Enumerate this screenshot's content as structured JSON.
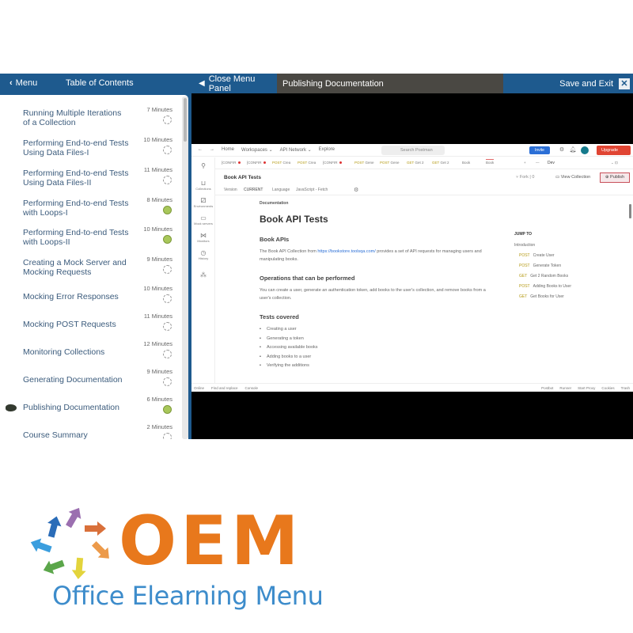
{
  "topbar": {
    "menu_label": "Menu",
    "toc_label": "Table of Contents",
    "close_panel_label": "Close Menu Panel",
    "current_title": "Publishing Documentation",
    "save_exit_label": "Save and Exit",
    "close_icon": "✕",
    "colors": {
      "primary": "#1e5a8e",
      "title_bg": "#4a4843"
    }
  },
  "toc": {
    "items": [
      {
        "label": "Running Multiple Iterations of a Collection",
        "duration": "7 Minutes",
        "status": "incomplete"
      },
      {
        "label": "Performing End-to-end Tests Using Data Files-I",
        "duration": "10 Minutes",
        "status": "incomplete"
      },
      {
        "label": "Performing End-to-end Tests Using Data Files-II",
        "duration": "11 Minutes",
        "status": "incomplete"
      },
      {
        "label": "Performing End-to-end Tests with Loops-I",
        "duration": "8 Minutes",
        "status": "complete"
      },
      {
        "label": "Performing End-to-end Tests with Loops-II",
        "duration": "10 Minutes",
        "status": "complete"
      },
      {
        "label": "Creating a Mock Server and Mocking Requests",
        "duration": "9 Minutes",
        "status": "incomplete"
      },
      {
        "label": "Mocking Error Responses",
        "duration": "10 Minutes",
        "status": "incomplete"
      },
      {
        "label": "Mocking POST Requests",
        "duration": "11 Minutes",
        "status": "incomplete"
      },
      {
        "label": "Monitoring Collections",
        "duration": "12 Minutes",
        "status": "incomplete"
      },
      {
        "label": "Generating Documentation",
        "duration": "9 Minutes",
        "status": "incomplete"
      },
      {
        "label": "Publishing Documentation",
        "duration": "6 Minutes",
        "status": "complete",
        "current": true
      },
      {
        "label": "Course Summary",
        "duration": "2 Minutes",
        "status": "incomplete"
      }
    ],
    "status_colors": {
      "complete": "#a8c75a"
    }
  },
  "postman": {
    "nav": [
      "←",
      "→",
      "Home",
      "Workspaces ⌄",
      "API Network ⌄",
      "Explore"
    ],
    "search_placeholder": "Search Postman",
    "invite_label": "Invite",
    "upgrade_label": "Upgrade",
    "tabs": [
      {
        "label": "[CONFIR",
        "method": "",
        "dot": true
      },
      {
        "label": "[CONFIR",
        "method": "",
        "dot": true
      },
      {
        "label": "Crea",
        "method": "POST",
        "dot": false
      },
      {
        "label": "Crea",
        "method": "POST",
        "dot": false
      },
      {
        "label": "[CONFIR",
        "method": "",
        "dot": true
      },
      {
        "label": "Gene",
        "method": "POST",
        "dot": false
      },
      {
        "label": "Gene",
        "method": "POST",
        "dot": false
      },
      {
        "label": "Get 2",
        "method": "GET",
        "dot": false
      },
      {
        "label": "Get 2",
        "method": "GET",
        "dot": false
      },
      {
        "label": "Book",
        "method": "",
        "dot": false
      },
      {
        "label": "Book",
        "method": "",
        "dot": false,
        "active": true
      }
    ],
    "environment": "Dev",
    "sidebar": [
      {
        "glyph": "⚲",
        "label": ""
      },
      {
        "glyph": "⊔",
        "label": "Collections"
      },
      {
        "glyph": "⚂",
        "label": "Environments"
      },
      {
        "glyph": "▭",
        "label": "Mock servers"
      },
      {
        "glyph": "⋈",
        "label": "Monitors"
      },
      {
        "glyph": "◷",
        "label": "History"
      },
      {
        "glyph": "⁂",
        "label": ""
      }
    ],
    "doc_title": "Book API Tests",
    "fork_label": "Fork",
    "fork_count": "0",
    "view_collection_label": "View Collection",
    "publish_label": "Publish",
    "version_label": "Version",
    "version_value": "CURRENT",
    "language_label": "Language",
    "language_value": "JavaScript - Fetch",
    "content": {
      "section_label": "Documentation",
      "title": "Book API Tests",
      "h_book_apis": "Book APIs",
      "p_intro_before": "The Book API Collection from ",
      "p_intro_link": "https://bookstore.toolsqa.com/",
      "p_intro_after": " provides a set of API requests for managing users and manipulating books.",
      "h_operations": "Operations that can be performed",
      "p_operations": "You can create a user, generate an authentication token, add books to the user's collection, and remove books from a user's collection.",
      "h_tests": "Tests covered",
      "tests": [
        "Creating a user",
        "Generating a token",
        "Accessing available books",
        "Adding books to a user",
        "Verifying the additions"
      ]
    },
    "jump_to": {
      "heading": "JUMP TO",
      "intro": "Introduction",
      "entries": [
        {
          "method": "POST",
          "label": "Create User"
        },
        {
          "method": "POST",
          "label": "Generate Token"
        },
        {
          "method": "GET",
          "label": "Get 2 Random Books"
        },
        {
          "method": "POST",
          "label": "Adding Books to User"
        },
        {
          "method": "GET",
          "label": "Get Books for User"
        }
      ]
    },
    "status_left": [
      "Online",
      "Find and replace",
      "Console"
    ],
    "status_right": [
      "Postbot",
      "Runner",
      "Start Proxy",
      "Cookies",
      "Trash"
    ]
  },
  "logo": {
    "brand": "OEM",
    "tagline": "Office Elearning Menu",
    "colors": {
      "brand": "#e8781c",
      "tagline": "#3d8ccb"
    },
    "arrow_colors": [
      "#2a6cb8",
      "#9b6fb0",
      "#d9703a",
      "#ec9a4a",
      "#e3d43c",
      "#5ba64a",
      "#3b9ede"
    ]
  }
}
